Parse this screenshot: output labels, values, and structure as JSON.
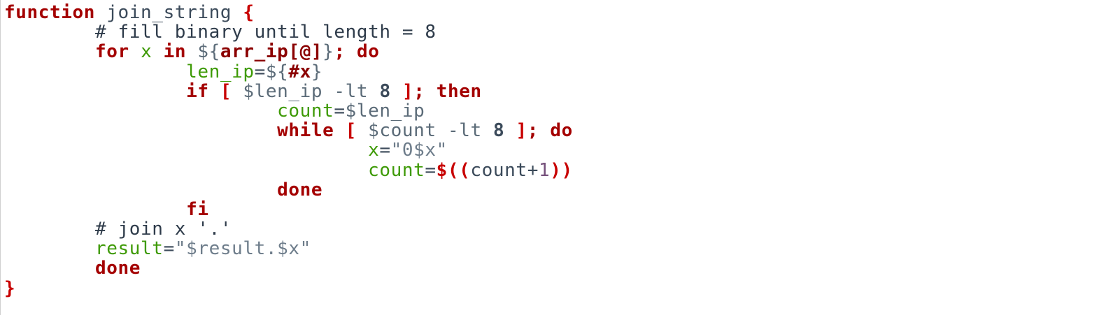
{
  "colors": {
    "background": "#ffffff",
    "keyword": "#a40000",
    "variable_assignment": "#3e9a06",
    "comment": "#2e3b4a",
    "string": "#6e7d8b",
    "number_literal": "#75507b"
  },
  "code": {
    "lines": [
      {
        "indent": "",
        "tokens": [
          {
            "type": "keyword",
            "text": "function"
          },
          {
            "type": "plain",
            "text": " "
          },
          {
            "type": "name",
            "text": "join_string"
          },
          {
            "type": "plain",
            "text": " "
          },
          {
            "type": "brace",
            "text": "{"
          }
        ]
      },
      {
        "indent": "        ",
        "tokens": [
          {
            "type": "comment",
            "text": "# fill binary until length = 8"
          }
        ]
      },
      {
        "indent": "        ",
        "tokens": [
          {
            "type": "keyword",
            "text": "for"
          },
          {
            "type": "plain",
            "text": " "
          },
          {
            "type": "var",
            "text": "x"
          },
          {
            "type": "plain",
            "text": " "
          },
          {
            "type": "keyword",
            "text": "in"
          },
          {
            "type": "plain",
            "text": " "
          },
          {
            "type": "expand",
            "text": "${"
          },
          {
            "type": "param",
            "text": "arr_ip[@]"
          },
          {
            "type": "expand",
            "text": "}"
          },
          {
            "type": "keyword",
            "text": ";"
          },
          {
            "type": "plain",
            "text": " "
          },
          {
            "type": "keyword",
            "text": "do"
          }
        ]
      },
      {
        "indent": "                ",
        "tokens": [
          {
            "type": "var",
            "text": "len_ip"
          },
          {
            "type": "op",
            "text": "="
          },
          {
            "type": "expand",
            "text": "${"
          },
          {
            "type": "param",
            "text": "#x"
          },
          {
            "type": "expand",
            "text": "}"
          }
        ]
      },
      {
        "indent": "                ",
        "tokens": [
          {
            "type": "keyword",
            "text": "if"
          },
          {
            "type": "plain",
            "text": " "
          },
          {
            "type": "bracket",
            "text": "["
          },
          {
            "type": "plain",
            "text": " "
          },
          {
            "type": "expand",
            "text": "$len_ip -lt"
          },
          {
            "type": "plain",
            "text": " "
          },
          {
            "type": "number",
            "text": "8"
          },
          {
            "type": "plain",
            "text": " "
          },
          {
            "type": "bracket",
            "text": "]"
          },
          {
            "type": "keyword",
            "text": ";"
          },
          {
            "type": "plain",
            "text": " "
          },
          {
            "type": "keyword",
            "text": "then"
          }
        ]
      },
      {
        "indent": "                        ",
        "tokens": [
          {
            "type": "var",
            "text": "count"
          },
          {
            "type": "op",
            "text": "="
          },
          {
            "type": "expand",
            "text": "$len_ip"
          }
        ]
      },
      {
        "indent": "                        ",
        "tokens": [
          {
            "type": "keyword",
            "text": "while"
          },
          {
            "type": "plain",
            "text": " "
          },
          {
            "type": "bracket",
            "text": "["
          },
          {
            "type": "plain",
            "text": " "
          },
          {
            "type": "expand",
            "text": "$count -lt"
          },
          {
            "type": "plain",
            "text": " "
          },
          {
            "type": "number",
            "text": "8"
          },
          {
            "type": "plain",
            "text": " "
          },
          {
            "type": "bracket",
            "text": "]"
          },
          {
            "type": "keyword",
            "text": ";"
          },
          {
            "type": "plain",
            "text": " "
          },
          {
            "type": "keyword",
            "text": "do"
          }
        ]
      },
      {
        "indent": "                                ",
        "tokens": [
          {
            "type": "var",
            "text": "x"
          },
          {
            "type": "op",
            "text": "="
          },
          {
            "type": "string",
            "text": "\"0$x\""
          }
        ]
      },
      {
        "indent": "                                ",
        "tokens": [
          {
            "type": "var",
            "text": "count"
          },
          {
            "type": "op",
            "text": "="
          },
          {
            "type": "bracket",
            "text": "$(("
          },
          {
            "type": "op",
            "text": "count+"
          },
          {
            "type": "numlit",
            "text": "1"
          },
          {
            "type": "bracket",
            "text": "))"
          }
        ]
      },
      {
        "indent": "                        ",
        "tokens": [
          {
            "type": "keyword",
            "text": "done"
          }
        ]
      },
      {
        "indent": "                ",
        "tokens": [
          {
            "type": "keyword",
            "text": "fi"
          }
        ]
      },
      {
        "indent": "        ",
        "tokens": [
          {
            "type": "comment",
            "text": "# join x '.'"
          }
        ]
      },
      {
        "indent": "        ",
        "tokens": [
          {
            "type": "var",
            "text": "result"
          },
          {
            "type": "op",
            "text": "="
          },
          {
            "type": "string",
            "text": "\"$result.$x\""
          }
        ]
      },
      {
        "indent": "        ",
        "tokens": [
          {
            "type": "keyword",
            "text": "done"
          }
        ]
      },
      {
        "indent": "",
        "tokens": [
          {
            "type": "brace",
            "text": "}"
          }
        ]
      }
    ]
  }
}
